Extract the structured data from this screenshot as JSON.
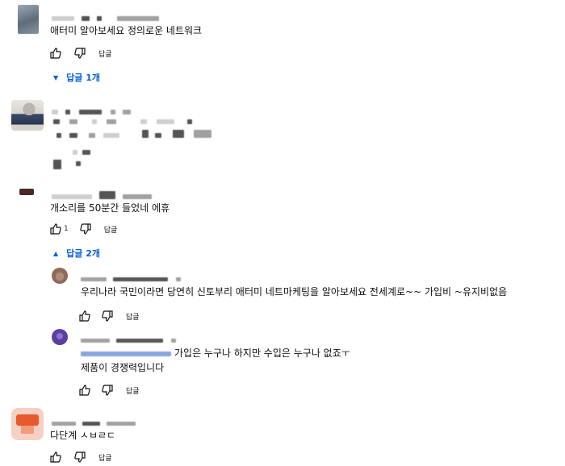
{
  "comments": [
    {
      "text": "애터미 알아보세요 정의로운 네트워크",
      "reply_label": "답글",
      "replies_toggle": "답글 1개"
    },
    {
      "text": "",
      "reply_label": ""
    },
    {
      "text": "개소리를 50분간 들었네 에휴",
      "like_count": "1",
      "reply_label": "답글",
      "replies_toggle": "답글 2개",
      "replies": [
        {
          "text": "우리나라 국민이라면  당연히 신토부리 애터미  네트마케팅을 알아보세요  전세계로~~ 가입비 ~유지비없음",
          "reply_label": "답글"
        },
        {
          "text_line1": "가입은 누구나  하지만 수입은 누구나 없죠ㅜ",
          "text_line2": "제품이 경쟁력입니다",
          "reply_label": "답글"
        }
      ]
    },
    {
      "text": "다단계 ㅅㅂㄹㄷ",
      "reply_label": "답글"
    }
  ],
  "colors": {
    "link_blue": "#065fd4",
    "text": "#0f0f0f"
  },
  "icons": [
    "thumbs-up-icon",
    "thumbs-down-icon",
    "chevron-down-icon",
    "chevron-up-icon"
  ]
}
